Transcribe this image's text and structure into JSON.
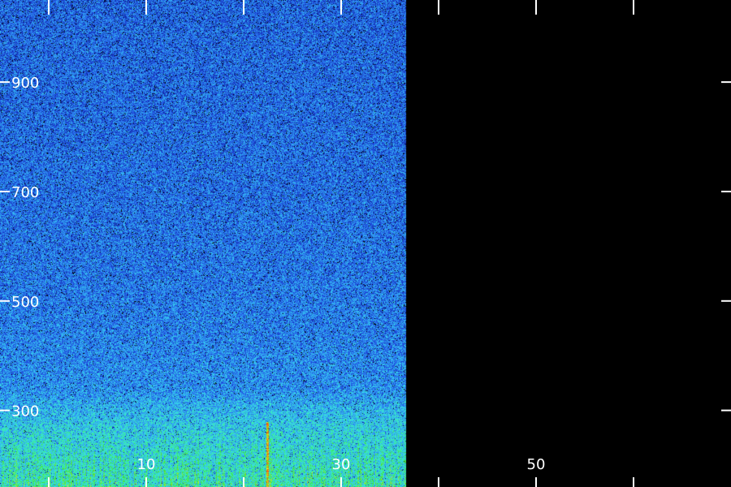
{
  "chart_data": {
    "type": "heatmap",
    "title": "",
    "xlabel": "",
    "ylabel": "",
    "xlim": [
      -5,
      70
    ],
    "ylim": [
      160,
      1050
    ],
    "x_ticks": [
      0,
      10,
      20,
      30,
      40,
      50,
      60
    ],
    "x_tick_labels": [
      "",
      "10",
      "",
      "30",
      "",
      "50",
      ""
    ],
    "y_ticks": [
      300,
      500,
      700,
      900
    ],
    "y_tick_labels": [
      "300",
      "500",
      "700",
      "900"
    ],
    "data_x_end": 36.7,
    "grid": false,
    "colormap": [
      "#000000",
      "#0a1a8c",
      "#1f4de0",
      "#2f8cf0",
      "#35d0f0",
      "#3cf0b0",
      "#40e030",
      "#e8e820",
      "#ff3000"
    ],
    "background_color": "#000000",
    "intensity_profile": {
      "description_free": true,
      "freq": [
        160,
        200,
        260,
        300,
        340,
        500,
        700,
        900,
        1050
      ],
      "mean_level": [
        0.62,
        0.58,
        0.52,
        0.46,
        0.38,
        0.34,
        0.32,
        0.31,
        0.3
      ]
    },
    "bright_streak": {
      "x": 22.4,
      "freq_range": [
        160,
        280
      ]
    }
  }
}
